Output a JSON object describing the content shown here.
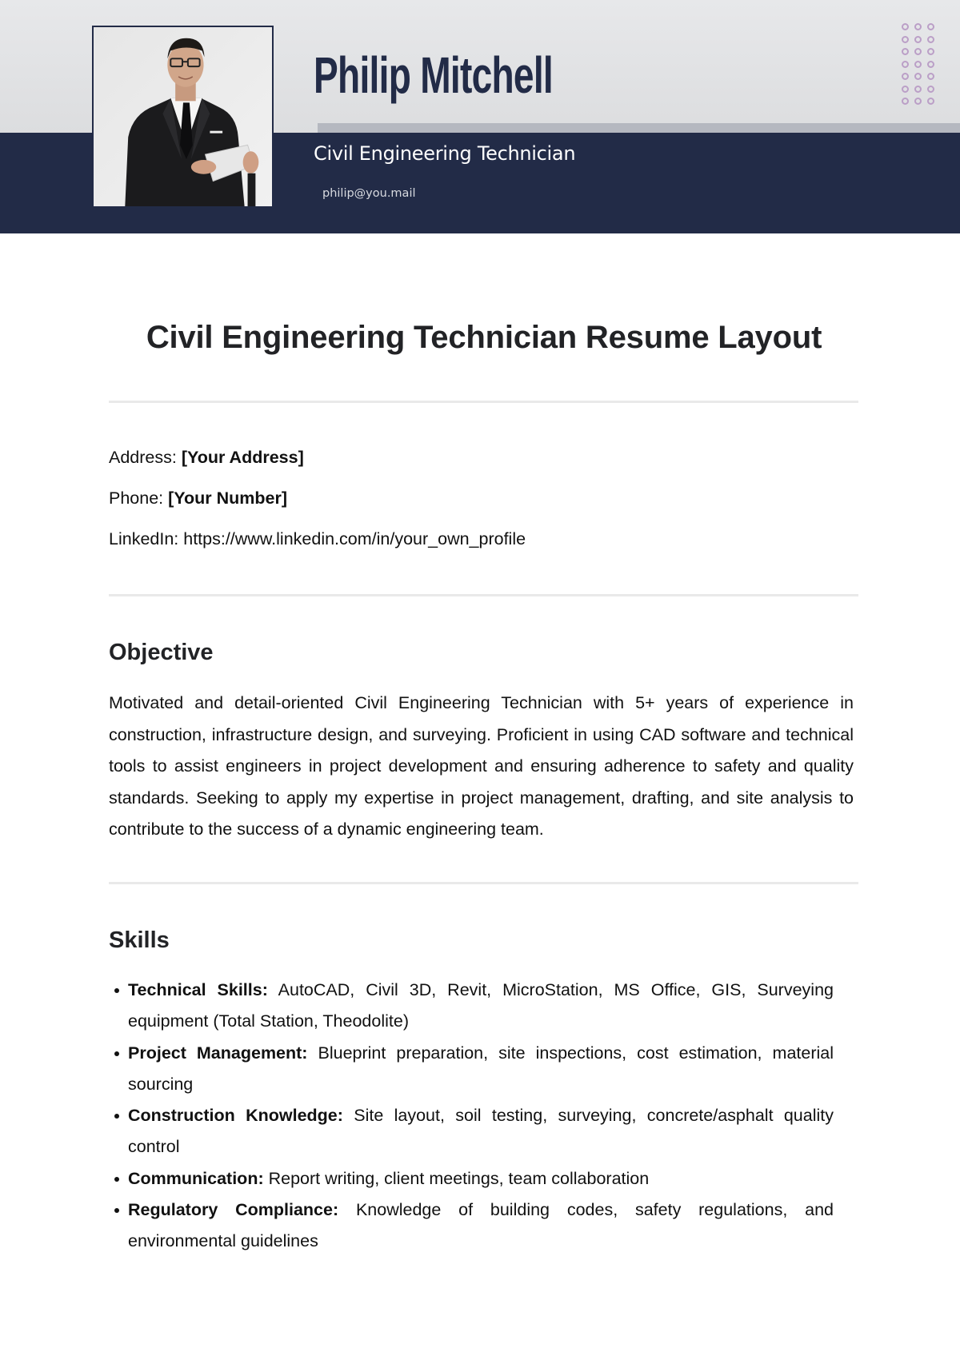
{
  "header": {
    "name": "Philip Mitchell",
    "job_title": "Civil Engineering Technician",
    "email": "philip@you.mail",
    "photo_alt": "Portrait of man in black suit holding tablet",
    "colors": {
      "navy": "#222b47",
      "light_bg": "#e4e5e7",
      "accent_bar": "#b5b8c0",
      "dot_pattern": "#bb9fc7"
    },
    "decoration_icon": "dot-grid-pattern"
  },
  "document": {
    "title": "Civil Engineering Technician Resume Layout"
  },
  "contact": {
    "address_label": "Address:",
    "address_value": "[Your Address]",
    "phone_label": "Phone:",
    "phone_value": "[Your Number]",
    "linkedin_label": "LinkedIn:",
    "linkedin_value": "https://www.linkedin.com/in/your_own_profile"
  },
  "objective": {
    "heading": "Objective",
    "text": "Motivated and detail-oriented Civil Engineering Technician with 5+ years of experience in construction, infrastructure design, and surveying. Proficient in using CAD software and technical tools to assist engineers in project development and ensuring adherence to safety and quality standards. Seeking to apply my expertise in project management, drafting, and site analysis to contribute to the success of a dynamic engineering team."
  },
  "skills": {
    "heading": "Skills",
    "items": [
      {
        "label": "Technical Skills:",
        "text": "AutoCAD, Civil 3D, Revit, MicroStation, MS Office, GIS, Surveying equipment (Total Station, Theodolite)"
      },
      {
        "label": "Project Management:",
        "text": "Blueprint preparation, site inspections, cost estimation, material sourcing"
      },
      {
        "label": "Construction Knowledge:",
        "text": "Site layout, soil testing, surveying, concrete/asphalt quality control"
      },
      {
        "label": "Communication:",
        "text": "Report writing, client meetings, team collaboration"
      },
      {
        "label": "Regulatory Compliance:",
        "text": "Knowledge of building codes, safety regulations, and environmental guidelines"
      }
    ]
  }
}
